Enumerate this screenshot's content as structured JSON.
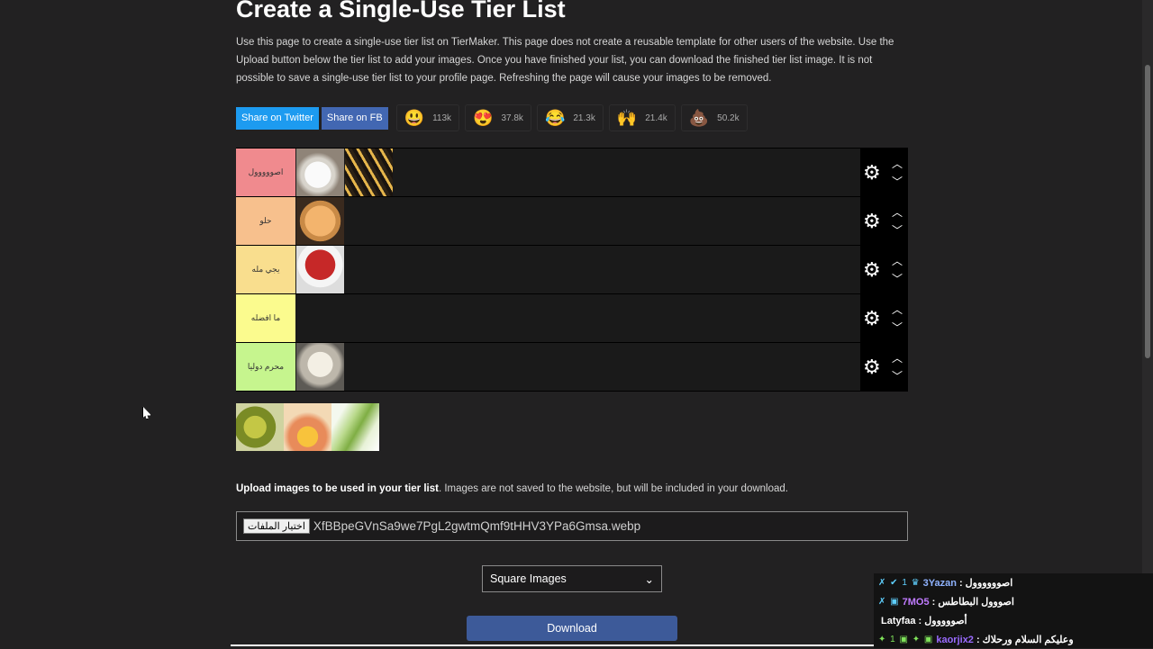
{
  "page": {
    "title": "Create a Single-Use Tier List",
    "intro": "Use this page to create a single-use tier list on TierMaker. This page does not create a reusable template for other users of the website. Use the Upload button below the tier list to add your images. Once you have finished your list, you can download the finished tier list image. It is not possible to save a single-use tier list to your profile page. Refreshing the page will cause your images to be removed."
  },
  "share": {
    "twitter_label": "Share on Twitter",
    "fb_label": "Share on FB",
    "reactions": [
      {
        "icon": "grinning-face-icon",
        "emoji": "😃",
        "count": "113k"
      },
      {
        "icon": "heart-eyes-icon",
        "emoji": "😍",
        "count": "37.8k"
      },
      {
        "icon": "tears-of-joy-icon",
        "emoji": "😂",
        "count": "21.3k"
      },
      {
        "icon": "raised-hands-icon",
        "emoji": "🙌",
        "count": "21.4k"
      },
      {
        "icon": "poop-icon",
        "emoji": "💩",
        "count": "50.2k"
      }
    ]
  },
  "tiers": [
    {
      "label": "اصووووول",
      "color": "#f08a8e",
      "items": [
        "sour-cream",
        "fries"
      ]
    },
    {
      "label": "حلو",
      "color": "#f7c08d",
      "items": [
        "hummus-sauce"
      ]
    },
    {
      "label": "يجي مله",
      "color": "#f9de8e",
      "items": [
        "tomato-soup"
      ]
    },
    {
      "label": "ما افضله",
      "color": "#fbfb8e",
      "items": []
    },
    {
      "label": "محرم دوليا",
      "color": "#c6f58e",
      "items": [
        "mayo"
      ]
    }
  ],
  "pool_items": [
    "pickles",
    "garlic-sauce",
    "lettuce"
  ],
  "upload": {
    "label_bold": "Upload images to be used in your tier list",
    "label_rest": ". Images are not saved to the website, but will be included in your download.",
    "button_label": "اختيار الملفات",
    "file_name": "XfBBpeGVnSa9we7PgL2gwtmQmf9tHHV3YPa6Gmsa.webp"
  },
  "image_mode": {
    "selected": "Square Images"
  },
  "download_label": "Download",
  "chat": [
    {
      "badges": "✗ ✔ 1 ♛",
      "user": "3Yazan",
      "user_color": "#8fb3ff",
      "message": ": اصوووووول"
    },
    {
      "badges": "✗ ▣",
      "user": "7MO5",
      "user_color": "#c07bff",
      "message": ": اصووول البطاطس"
    },
    {
      "badges": "",
      "user": "Latyfaa",
      "user_color": "#ffffff",
      "message": ": أصووووول"
    },
    {
      "badges": "✦ 1 ▣ ✦ ▣",
      "user": "kaorjix2",
      "user_color": "#9a6bff",
      "message": ": وعليكم السلام ورحلاك"
    }
  ],
  "colors": {
    "background": "#222122",
    "twitter": "#1d9bf0",
    "facebook": "#4267b2",
    "download": "#3d5a99"
  }
}
